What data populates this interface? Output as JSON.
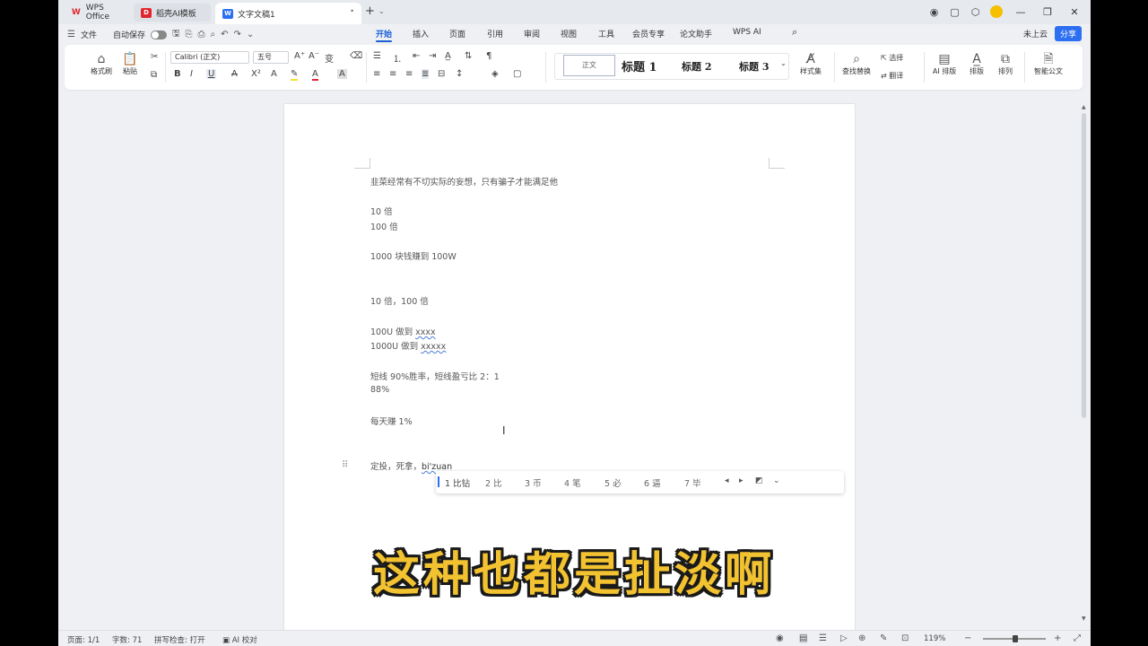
{
  "titlebar": {
    "tabs": [
      {
        "label": "WPS Office"
      },
      {
        "label": "稻壳AI模板"
      },
      {
        "label": "文字文稿1"
      }
    ],
    "close_glyph": "•",
    "new_tab_glyph": "+"
  },
  "menu": {
    "file": "文件",
    "autosave": "自动保存",
    "tabs": [
      "开始",
      "插入",
      "页面",
      "引用",
      "审阅",
      "视图",
      "工具",
      "会员专享",
      "论文助手",
      "WPS AI"
    ],
    "cloud": "未上云",
    "share": "分享"
  },
  "ribbon": {
    "format_painter": "格式刷",
    "paste": "粘贴",
    "font_name": "Calibri (正文)",
    "font_size": "五号",
    "styles": {
      "normal": "正文",
      "h1": "标题 1",
      "h2": "标题 2",
      "h3": "标题 3"
    },
    "style_set": "样式集",
    "find_replace": "查找替换",
    "select": "选择",
    "translate": "翻译",
    "ai_layout": "AI 排版",
    "layout": "排版",
    "arrange": "排列",
    "smart_doc": "智能公文"
  },
  "document": {
    "lines": [
      "韭菜经常有不切实际的妄想，只有骗子才能满足他",
      "10 倍",
      "100 倍",
      "1000 块钱赚到 100W",
      "10 倍，100 倍",
      "100U 做到 ",
      "1000U 做到 ",
      "短线 90%胜率，短线盈亏比 2：1",
      "88%",
      "每天赚 1%",
      "定投，死拿，"
    ],
    "squiggle_words": [
      "xxxx",
      "xxxxx",
      "bi'zuan"
    ]
  },
  "ime": {
    "candidates": [
      "1 比钻",
      "2 比",
      "3 币",
      "4 笔",
      "5 必",
      "6 逼",
      "7 毕"
    ]
  },
  "subtitle": "这种也都是扯淡啊",
  "statusbar": {
    "page": "页面: 1/1",
    "words": "字数: 71",
    "spellcheck": "拼写检查: 打开",
    "ai_proof": "AI 校对",
    "zoom": "119%"
  },
  "colors": {
    "accent": "#2c6ff0",
    "subtitle": "#f2c230"
  }
}
